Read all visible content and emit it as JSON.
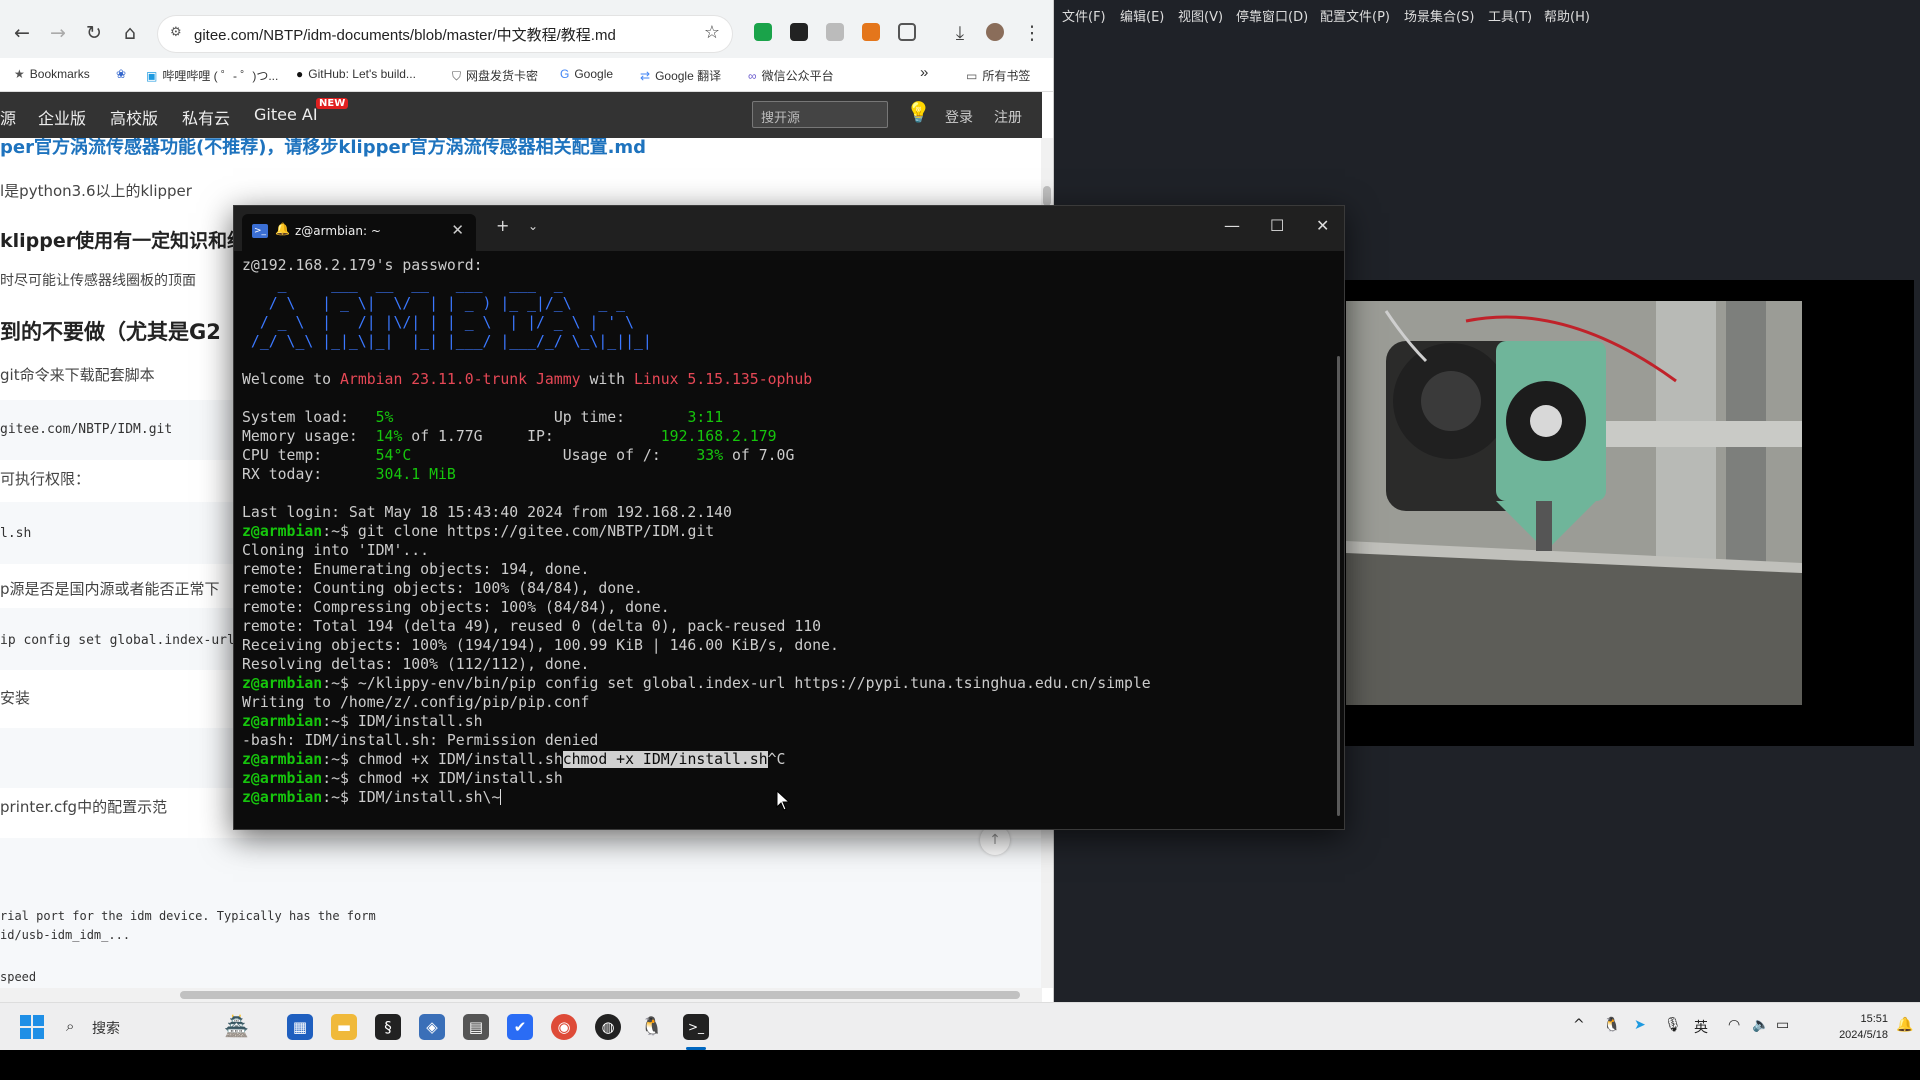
{
  "browser": {
    "url": "gitee.com/NBTP/idm-documents/blob/master/中文教程/教程.md",
    "bookmarks": [
      {
        "icon": "star-icon",
        "label": "Bookmarks"
      },
      {
        "icon": "paw-icon",
        "label": ""
      },
      {
        "icon": "tv-icon",
        "label": "哔哩哔哩 ( ゜- ゜)つ..."
      },
      {
        "icon": "github-icon",
        "label": "GitHub: Let's build..."
      },
      {
        "icon": "shield-icon",
        "label": "网盘发货卡密"
      },
      {
        "icon": "google-icon",
        "label": "Google"
      },
      {
        "icon": "translate-icon",
        "label": "Google 翻译"
      },
      {
        "icon": "wechat-icon",
        "label": "微信公众平台"
      }
    ],
    "bookmarks_more": "»",
    "all_bookmarks": "所有书签",
    "gitee_nav": {
      "items": [
        "源",
        "企业版",
        "高校版",
        "私有云",
        "Gitee AI"
      ],
      "new_badge": "NEW",
      "search_placeholder": "搜开源",
      "login": "登录",
      "register": "注册"
    },
    "content": {
      "line1": "per官方涡流传感器功能(不推荐)，请移步klipper官方涡流传感器相关配置.md",
      "line2": "l是python3.6以上的klipper",
      "line3": "klipper使用有一定知识和经",
      "line4": "时尽可能让传感器线圈板的顶面",
      "line5": "到的不要做（尤其是G2",
      "line6": "git命令来下载配套脚本",
      "code1": "gitee.com/NBTP/IDM.git",
      "line7": "可执行权限：",
      "code2": "l.sh",
      "line8": "p源是否是国内源或者能否正常下",
      "code3": "ip config set global.index-url h",
      "line9": "安装",
      "line10": "printer.cfg中的配置示范",
      "code4a": "rial port for the idm device. Typically has the form",
      "code4b": "id/usb-idm_idm_...",
      "code4c": "speed"
    }
  },
  "app": {
    "menu": [
      "文件(F)",
      "编辑(E)",
      "视图(V)",
      "停靠窗口(D)",
      "配置文件(P)",
      "场景集合(S)",
      "工具(T)",
      "帮助(H)"
    ]
  },
  "terminal": {
    "tab_title": "z@armbian: ~",
    "password_prompt": "z@192.168.2.179's password:",
    "welcome_prefix": "Welcome to ",
    "os_name": "Armbian 23.11.0-trunk Jammy",
    "welcome_mid": " with ",
    "kernel": "Linux 5.15.135-ophub",
    "stats": {
      "system_load_label": "System load:",
      "system_load": "5%",
      "up_time_label": "Up time:",
      "up_time": "3:11",
      "memory_label": "Memory usage:",
      "memory_pct": "14%",
      "memory_total": " of 1.77G",
      "ip_label": "IP:",
      "ip": "192.168.2.179",
      "cpu_label": "CPU temp:",
      "cpu_temp": "54°C",
      "usage_label": "Usage of /:",
      "usage_pct": "33%",
      "usage_total": " of 7.0G",
      "rx_label": "RX today:",
      "rx": "304.1 MiB"
    },
    "last_login": "Last login: Sat May 18 15:43:40 2024 from 192.168.2.140",
    "prompt_user": "z@armbian",
    "prompt_suffix": ":~$ ",
    "lines": [
      {
        "type": "cmd",
        "text": "git clone https://gitee.com/NBTP/IDM.git"
      },
      {
        "type": "out",
        "text": "Cloning into 'IDM'..."
      },
      {
        "type": "out",
        "text": "remote: Enumerating objects: 194, done."
      },
      {
        "type": "out",
        "text": "remote: Counting objects: 100% (84/84), done."
      },
      {
        "type": "out",
        "text": "remote: Compressing objects: 100% (84/84), done."
      },
      {
        "type": "out",
        "text": "remote: Total 194 (delta 49), reused 0 (delta 0), pack-reused 110"
      },
      {
        "type": "out",
        "text": "Receiving objects: 100% (194/194), 100.99 KiB | 146.00 KiB/s, done."
      },
      {
        "type": "out",
        "text": "Resolving deltas: 100% (112/112), done."
      },
      {
        "type": "cmd",
        "text": "~/klippy-env/bin/pip config set global.index-url https://pypi.tuna.tsinghua.edu.cn/simple"
      },
      {
        "type": "out",
        "text": "Writing to /home/z/.config/pip/pip.conf"
      },
      {
        "type": "cmd",
        "text": "IDM/install.sh"
      },
      {
        "type": "out",
        "text": "-bash: IDM/install.sh: Permission denied"
      },
      {
        "type": "cmdsel",
        "text": "chmod +x IDM/install.sh",
        "selected": "chmod +x IDM/install.sh",
        "tail": "^C"
      },
      {
        "type": "cmd",
        "text": "chmod +x IDM/install.sh"
      },
      {
        "type": "cmdcur",
        "text": "IDM/install.sh\\~"
      }
    ]
  },
  "taskbar": {
    "search": "搜索",
    "ime": "英",
    "time": "15:51",
    "date": "2024/5/18"
  },
  "colors": {
    "terminal_bg": "#0c0c0c",
    "prompt_green": "#16c60c",
    "logo_blue": "#3b78ff",
    "os_red": "#e74856",
    "gitee_nav": "#333333",
    "link_blue": "#1e73be"
  }
}
